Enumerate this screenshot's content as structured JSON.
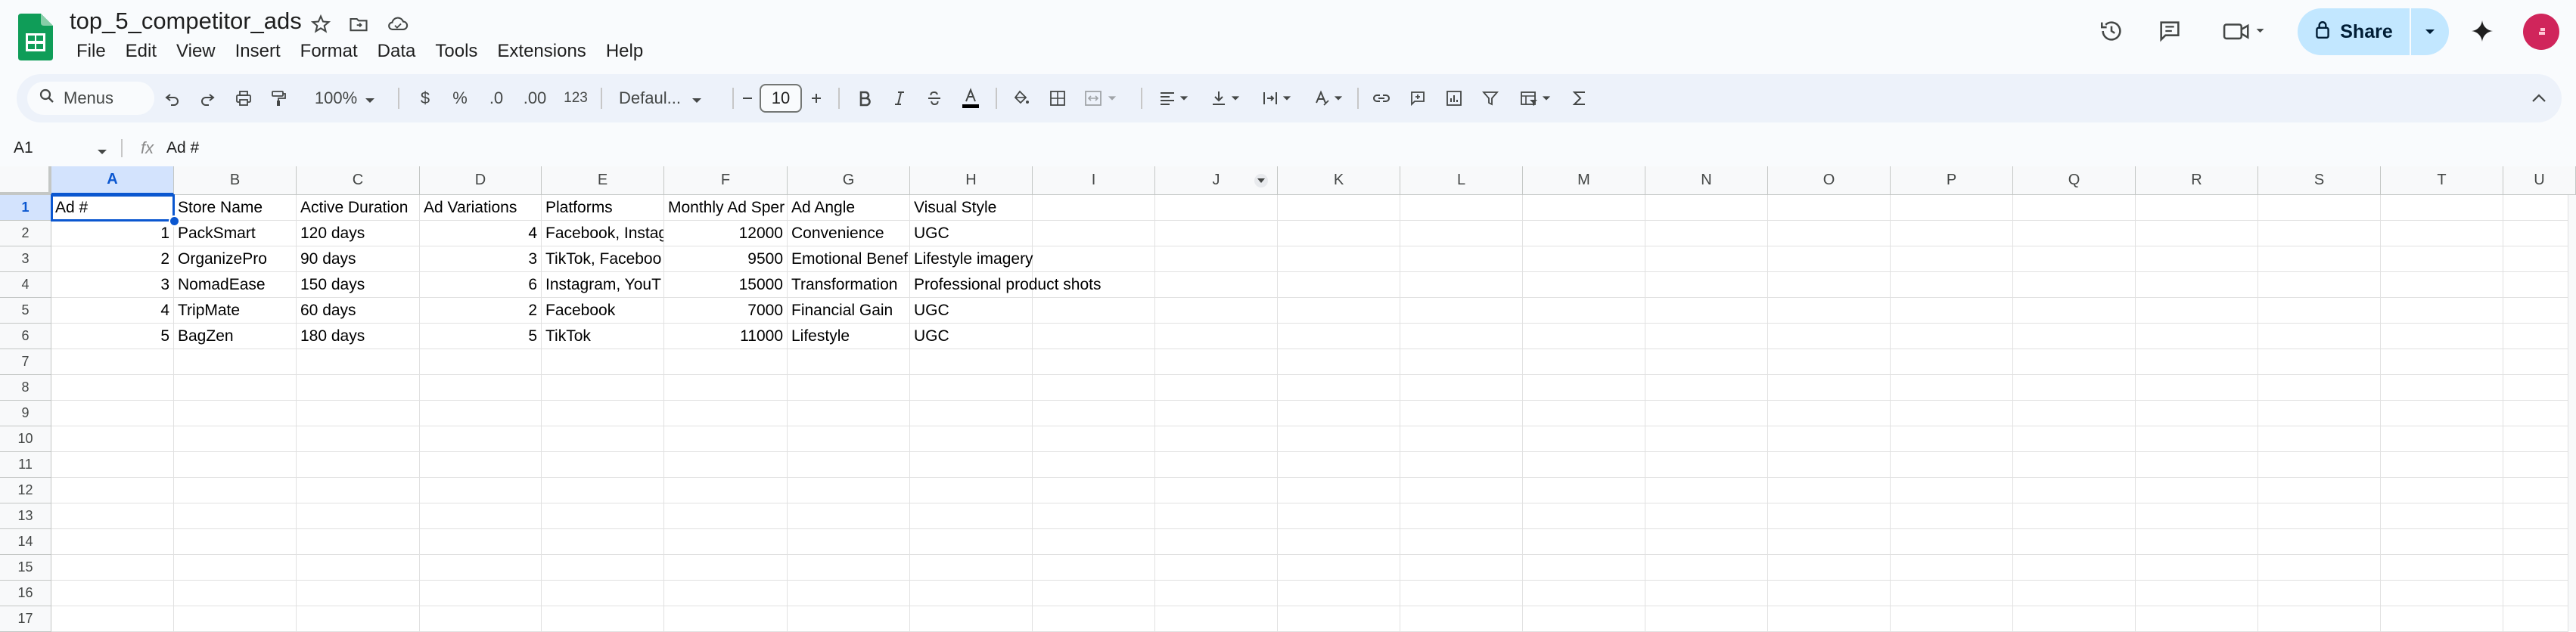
{
  "document": {
    "title": "top_5_competitor_ads"
  },
  "menu": [
    "File",
    "Edit",
    "View",
    "Insert",
    "Format",
    "Data",
    "Tools",
    "Extensions",
    "Help"
  ],
  "toolbar": {
    "search_label": "Menus",
    "zoom": "100%",
    "currency": "$",
    "percent": "%",
    "decrease_decimal": ".0",
    "increase_decimal": ".00",
    "number_format": "123",
    "font": "Defaul...",
    "font_size": "10"
  },
  "share": {
    "label": "Share"
  },
  "formula_bar": {
    "cell_ref": "A1",
    "fx": "fx",
    "content": "Ad #"
  },
  "columns": [
    "A",
    "B",
    "C",
    "D",
    "E",
    "F",
    "G",
    "H",
    "I",
    "J",
    "K",
    "L",
    "M",
    "N",
    "O",
    "P",
    "Q",
    "R",
    "S",
    "T",
    "U"
  ],
  "rows": [
    "1",
    "2",
    "3",
    "4",
    "5",
    "6",
    "7",
    "8",
    "9",
    "10",
    "11",
    "12",
    "13",
    "14",
    "15",
    "16",
    "17"
  ],
  "table": {
    "headers": [
      "Ad #",
      "Store Name",
      "Active Duration",
      "Ad Variations",
      "Platforms",
      "Monthly Ad Sper",
      "Ad Angle",
      "Visual Style"
    ],
    "data": [
      [
        "1",
        "PackSmart",
        "120 days",
        "4",
        "Facebook, Instag",
        "12000",
        "Convenience",
        "UGC"
      ],
      [
        "2",
        "OrganizePro",
        "90 days",
        "3",
        "TikTok, Faceboo",
        "9500",
        "Emotional Benef",
        "Lifestyle imagery"
      ],
      [
        "3",
        "NomadEase",
        "150 days",
        "6",
        "Instagram, YouT",
        "15000",
        "Transformation",
        "Professional product shots"
      ],
      [
        "4",
        "TripMate",
        "60 days",
        "2",
        "Facebook",
        "7000",
        "Financial Gain",
        "UGC"
      ],
      [
        "5",
        "BagZen",
        "180 days",
        "5",
        "TikTok",
        "11000",
        "Lifestyle",
        "UGC"
      ]
    ]
  },
  "colors": {
    "accent": "#0b57d0",
    "share_bg": "#c2e7ff",
    "avatar": "#d0255b",
    "sheets_green": "#0f9d58"
  }
}
